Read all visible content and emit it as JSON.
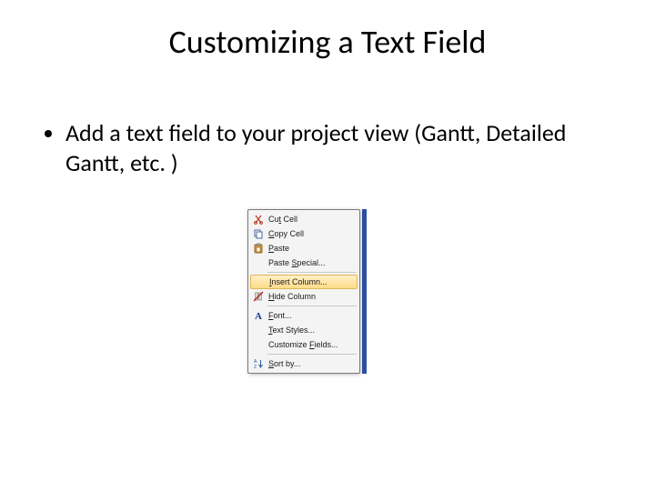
{
  "title": "Customizing a Text Field",
  "bullet": "Add a text field to your project view (Gantt, Detailed Gantt, etc. )",
  "menu": {
    "items": [
      {
        "key": "cut",
        "label": "Cut Cell",
        "icon": "scissors-icon",
        "u": 2
      },
      {
        "key": "copy",
        "label": "Copy Cell",
        "icon": "copy-icon",
        "u": 0
      },
      {
        "key": "paste",
        "label": "Paste",
        "icon": "paste-icon",
        "u": 0
      },
      {
        "key": "paste-special",
        "label": "Paste Special...",
        "icon": null,
        "u": 6
      },
      {
        "divider": true
      },
      {
        "key": "insert-column",
        "label": "Insert Column...",
        "icon": null,
        "u": 0,
        "highlight": true
      },
      {
        "key": "hide-column",
        "label": "Hide Column",
        "icon": "hide-icon",
        "u": 0
      },
      {
        "divider": true
      },
      {
        "key": "font",
        "label": "Font...",
        "icon": "font-icon",
        "u": 0
      },
      {
        "key": "text-styles",
        "label": "Text Styles...",
        "icon": null,
        "u": 0
      },
      {
        "key": "customize",
        "label": "Customize Fields...",
        "icon": null,
        "u": 10
      },
      {
        "divider": true
      },
      {
        "key": "sort",
        "label": "Sort by...",
        "icon": "sort-icon",
        "u": 0
      }
    ]
  }
}
